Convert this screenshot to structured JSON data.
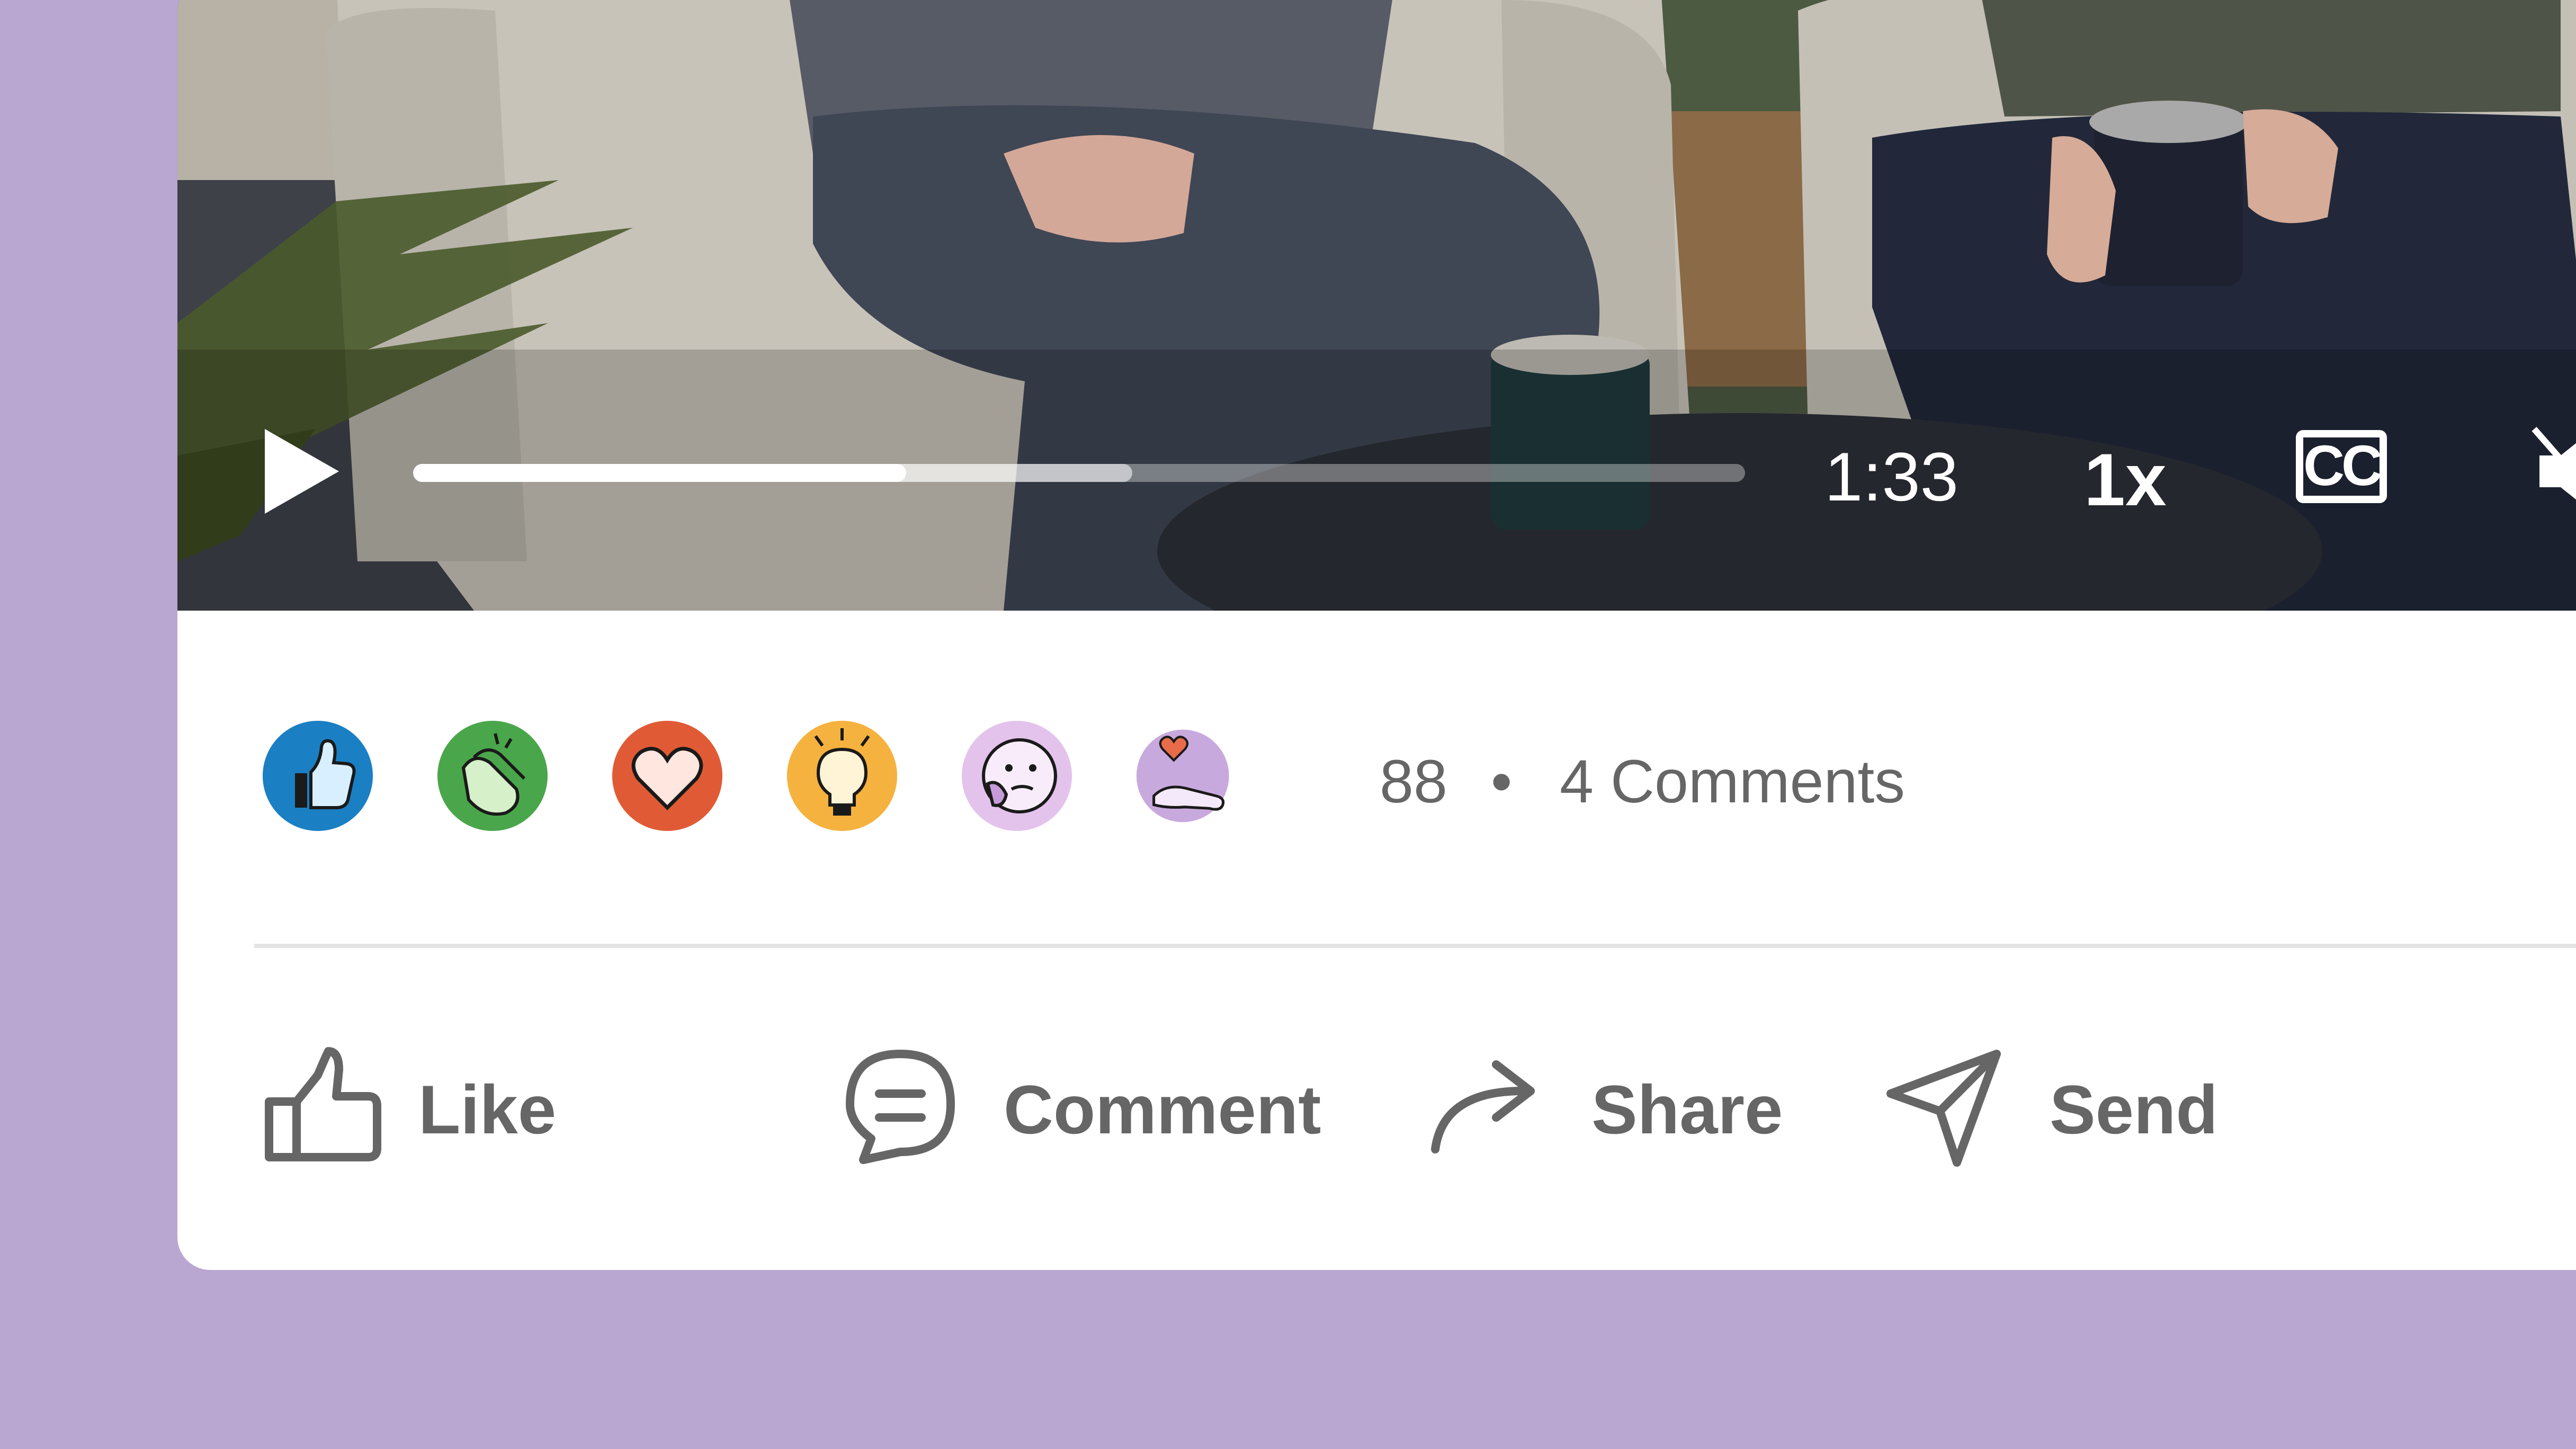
{
  "video": {
    "time": "1:33",
    "speed": "1x",
    "captions_label": "CC",
    "progress_played": 0.37,
    "progress_buffered": 0.54
  },
  "reactions": [
    {
      "name": "like-reaction-icon",
      "color": "#1b7fc3"
    },
    {
      "name": "celebrate-reaction-icon",
      "color": "#4aa64b"
    },
    {
      "name": "love-reaction-icon",
      "color": "#e05b35"
    },
    {
      "name": "insightful-reaction-icon",
      "color": "#f5b23e"
    },
    {
      "name": "curious-reaction-icon",
      "color": "#e3c3ec"
    },
    {
      "name": "support-reaction-icon",
      "color": "#c8a9dd"
    }
  ],
  "social": {
    "reaction_count": "88",
    "separator": "•",
    "comments": "4 Comments"
  },
  "actions": {
    "like": "Like",
    "comment": "Comment",
    "share": "Share",
    "send": "Send"
  },
  "colors": {
    "background": "#b9a6d1",
    "card": "#ffffff",
    "muted_text": "#666666"
  }
}
